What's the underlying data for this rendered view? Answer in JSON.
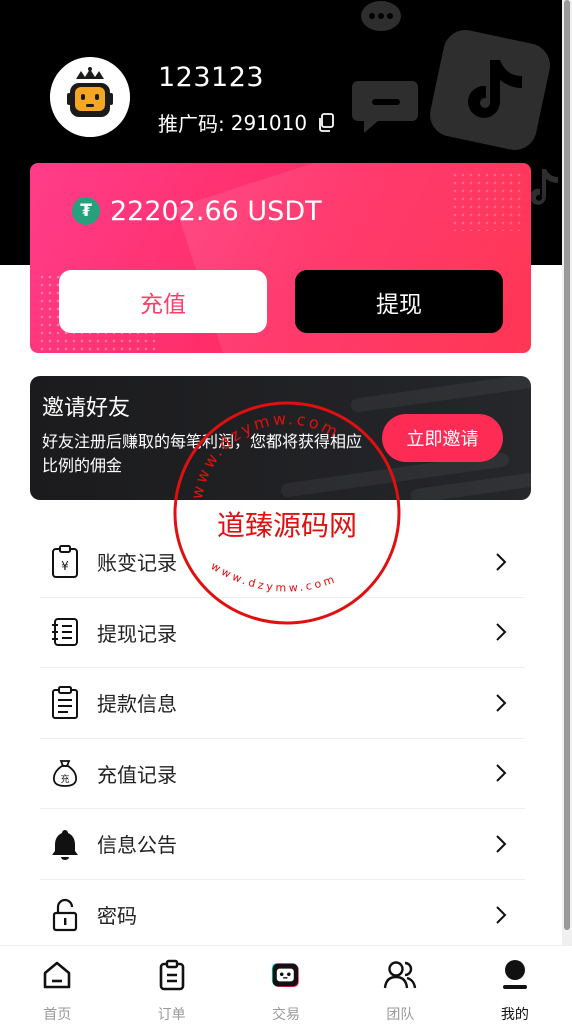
{
  "user": {
    "username": "123123",
    "referral_label": "推广码:",
    "referral_code": "291010"
  },
  "wallet": {
    "balance": "22202.66 USDT",
    "currency_icon": "tether-icon",
    "recharge_label": "充值",
    "withdraw_label": "提现",
    "accent_color": "#ff2b63"
  },
  "invite": {
    "title": "邀请好友",
    "description": "好友注册后赚取的每笔利润，您都将获得相应比例的佣金",
    "button_label": "立即邀请"
  },
  "menu": {
    "items": [
      {
        "label": "账变记录",
        "icon": "yen-clipboard-icon"
      },
      {
        "label": "提现记录",
        "icon": "notebook-icon"
      },
      {
        "label": "提款信息",
        "icon": "clipboard-list-icon"
      },
      {
        "label": "充值记录",
        "icon": "money-bag-icon"
      },
      {
        "label": "信息公告",
        "icon": "bell-icon"
      },
      {
        "label": "密码",
        "icon": "lock-icon"
      }
    ]
  },
  "watermark": {
    "main_text": "道臻源码网",
    "arc_text": "www.dzymw.com"
  },
  "tabbar": {
    "items": [
      {
        "label": "首页",
        "icon": "home-icon"
      },
      {
        "label": "订单",
        "icon": "order-clipboard-icon"
      },
      {
        "label": "交易",
        "icon": "robot-icon"
      },
      {
        "label": "团队",
        "icon": "team-icon"
      },
      {
        "label": "我的",
        "icon": "profile-icon"
      }
    ],
    "active_index": 4
  }
}
